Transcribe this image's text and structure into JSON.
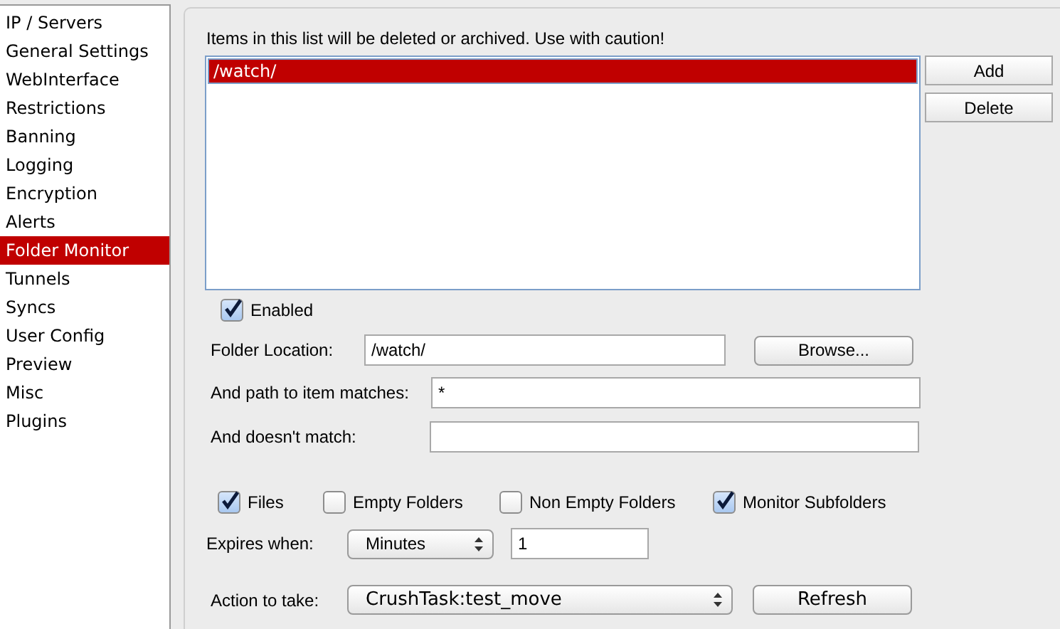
{
  "sidebar": {
    "items": [
      {
        "label": "IP / Servers",
        "selected": false
      },
      {
        "label": "General Settings",
        "selected": false
      },
      {
        "label": "WebInterface",
        "selected": false
      },
      {
        "label": "Restrictions",
        "selected": false
      },
      {
        "label": "Banning",
        "selected": false
      },
      {
        "label": "Logging",
        "selected": false
      },
      {
        "label": "Encryption",
        "selected": false
      },
      {
        "label": "Alerts",
        "selected": false
      },
      {
        "label": "Folder Monitor",
        "selected": true
      },
      {
        "label": "Tunnels",
        "selected": false
      },
      {
        "label": "Syncs",
        "selected": false
      },
      {
        "label": "User Config",
        "selected": false
      },
      {
        "label": "Preview",
        "selected": false
      },
      {
        "label": "Misc",
        "selected": false
      },
      {
        "label": "Plugins",
        "selected": false
      }
    ]
  },
  "warning": "Items in this list will be deleted or archived.  Use with caution!",
  "folders": [
    {
      "label": "/watch/",
      "selected": true
    }
  ],
  "list_buttons": [
    "Add",
    "Delete"
  ],
  "enabled": {
    "label": "Enabled",
    "checked": true
  },
  "folder_location": {
    "label": "Folder Location:",
    "value": "/watch/",
    "button": "Browse..."
  },
  "path_matches": {
    "label": "And path to item matches:",
    "value": "*"
  },
  "doesnt_match": {
    "label": "And doesn't match:"
  },
  "options": [
    {
      "label": "Files",
      "checked": true
    },
    {
      "label": "Empty Folders",
      "checked": false
    },
    {
      "label": "Non Empty Folders",
      "checked": false
    },
    {
      "label": "Monitor Subfolders",
      "checked": true
    }
  ],
  "expires": {
    "label": "Expires when:",
    "unit": "Minutes",
    "value": "1"
  },
  "action": {
    "label": "Action to take:",
    "value": "CrushTask:test_move",
    "button": "Refresh"
  }
}
